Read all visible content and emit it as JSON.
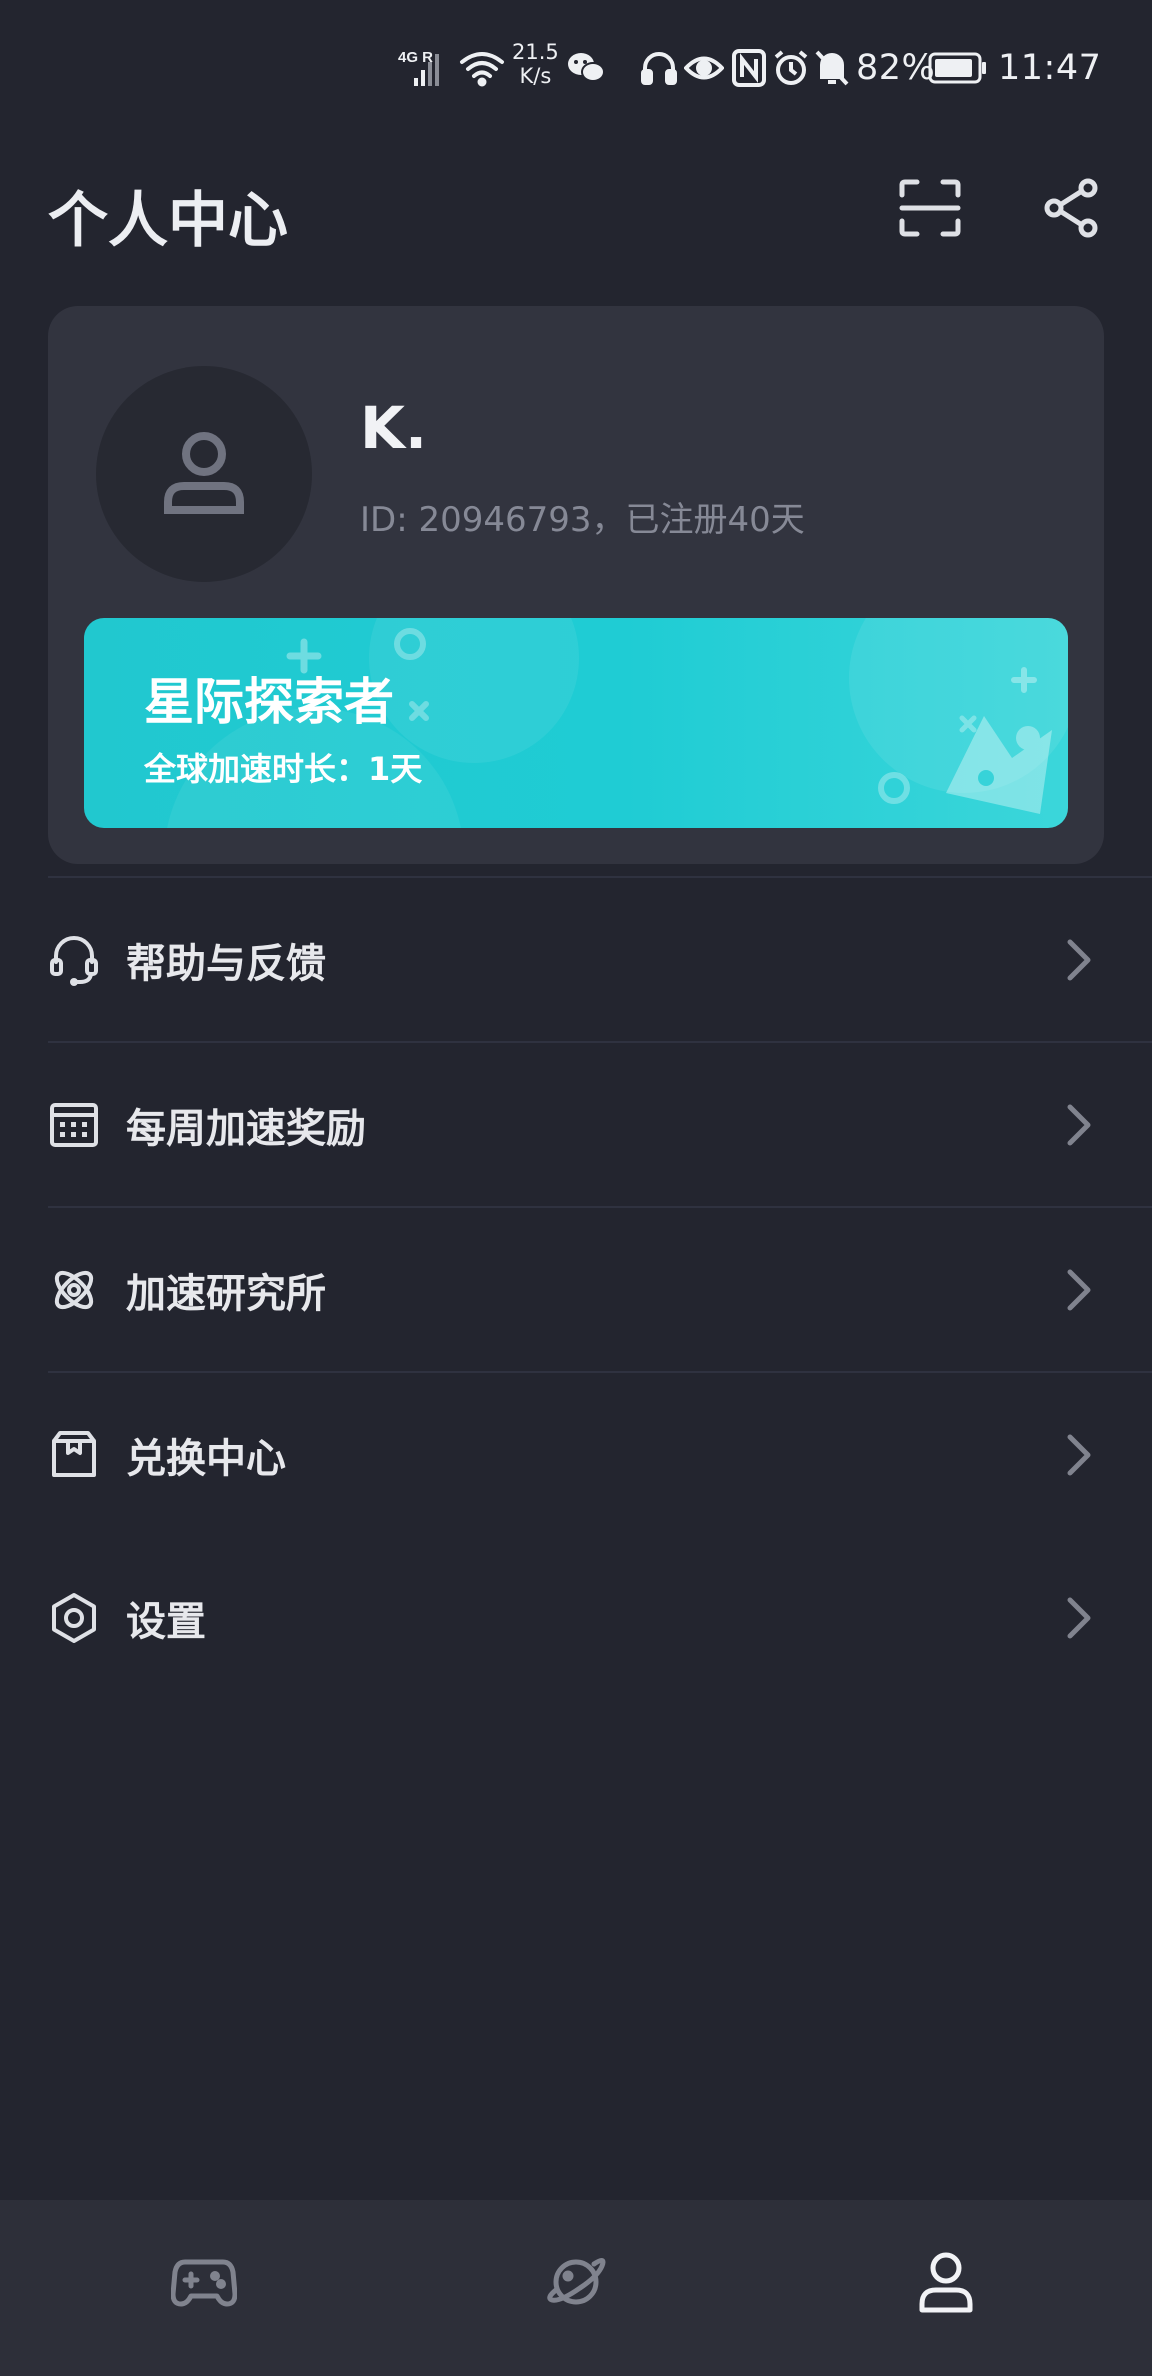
{
  "status_bar": {
    "network": "4G R",
    "speed_value": "21.5",
    "speed_unit": "K/s",
    "battery_percent": "82%",
    "time": "11:47"
  },
  "header": {
    "title": "个人中心"
  },
  "profile": {
    "name": "K.",
    "meta": "ID: 20946793，已注册40天"
  },
  "vip": {
    "title": "星际探索者",
    "subtitle": "全球加速时长：1天"
  },
  "menu": [
    {
      "label": "帮助与反馈",
      "icon": "headset-icon"
    },
    {
      "label": "每周加速奖励",
      "icon": "calendar-icon"
    },
    {
      "label": "加速研究所",
      "icon": "atom-icon"
    },
    {
      "label": "兑换中心",
      "icon": "gift-box-icon"
    },
    {
      "label": "设置",
      "icon": "settings-hexagon-icon"
    }
  ],
  "tabs": [
    {
      "icon": "gamepad-icon",
      "active": false
    },
    {
      "icon": "planet-icon",
      "active": false
    },
    {
      "icon": "user-icon",
      "active": true
    }
  ],
  "colors": {
    "background": "#23252f",
    "card": "#32343f",
    "accent": "#1fccd4",
    "tab_bar": "#2d2f39"
  }
}
